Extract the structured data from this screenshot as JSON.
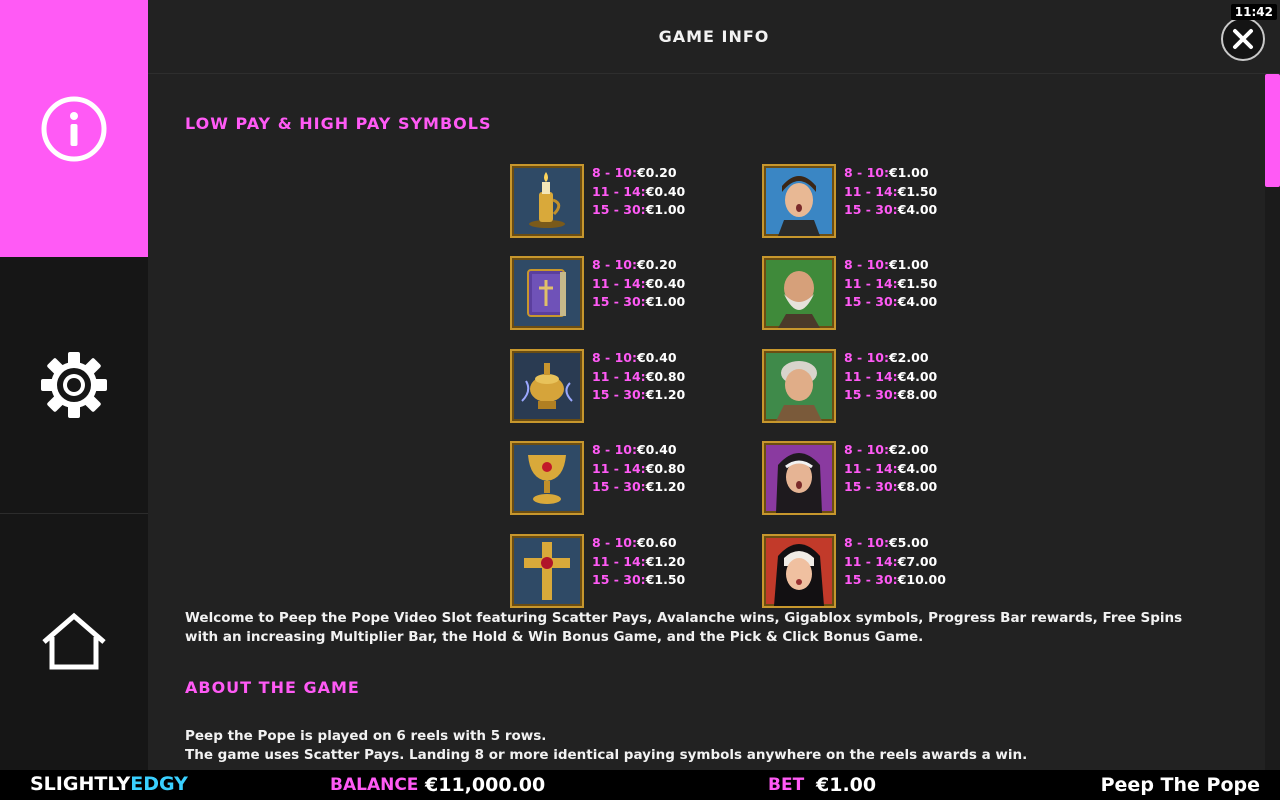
{
  "header": {
    "title": "GAME INFO",
    "clock": "11:42"
  },
  "sidebar": {
    "items": [
      {
        "name": "info",
        "icon": "info-icon",
        "active": true
      },
      {
        "name": "settings",
        "icon": "gear-icon",
        "active": false
      },
      {
        "name": "home",
        "icon": "home-icon",
        "active": false
      }
    ]
  },
  "colors": {
    "accent": "#ff5af5",
    "background": "#222222",
    "sidebar": "#161616",
    "tile_border": "#c7972d"
  },
  "sections": {
    "paytable_title": "LOW PAY & HIGH PAY SYMBOLS",
    "about_title": "ABOUT THE GAME"
  },
  "low_pay": [
    {
      "symbol": "candle-icon",
      "pays": [
        {
          "range": "8 - 10:",
          "amount": "€0.20"
        },
        {
          "range": "11 - 14:",
          "amount": "€0.40"
        },
        {
          "range": "15 - 30:",
          "amount": "€1.00"
        }
      ]
    },
    {
      "symbol": "book-icon",
      "pays": [
        {
          "range": "8 - 10:",
          "amount": "€0.20"
        },
        {
          "range": "11 - 14:",
          "amount": "€0.40"
        },
        {
          "range": "15 - 30:",
          "amount": "€1.00"
        }
      ]
    },
    {
      "symbol": "censer-icon",
      "pays": [
        {
          "range": "8 - 10:",
          "amount": "€0.40"
        },
        {
          "range": "11 - 14:",
          "amount": "€0.80"
        },
        {
          "range": "15 - 30:",
          "amount": "€1.20"
        }
      ]
    },
    {
      "symbol": "chalice-icon",
      "pays": [
        {
          "range": "8 - 10:",
          "amount": "€0.40"
        },
        {
          "range": "11 - 14:",
          "amount": "€0.80"
        },
        {
          "range": "15 - 30:",
          "amount": "€1.20"
        }
      ]
    },
    {
      "symbol": "cross-icon",
      "pays": [
        {
          "range": "8 - 10:",
          "amount": "€0.60"
        },
        {
          "range": "11 - 14:",
          "amount": "€1.20"
        },
        {
          "range": "15 - 30:",
          "amount": "€1.50"
        }
      ]
    }
  ],
  "high_pay": [
    {
      "symbol": "boy-icon",
      "pays": [
        {
          "range": "8 - 10:",
          "amount": "€1.00"
        },
        {
          "range": "11 - 14:",
          "amount": "€1.50"
        },
        {
          "range": "15 - 30:",
          "amount": "€4.00"
        }
      ]
    },
    {
      "symbol": "old-man-icon",
      "pays": [
        {
          "range": "8 - 10:",
          "amount": "€1.00"
        },
        {
          "range": "11 - 14:",
          "amount": "€1.50"
        },
        {
          "range": "15 - 30:",
          "amount": "€4.00"
        }
      ]
    },
    {
      "symbol": "old-woman-icon",
      "pays": [
        {
          "range": "8 - 10:",
          "amount": "€2.00"
        },
        {
          "range": "11 - 14:",
          "amount": "€4.00"
        },
        {
          "range": "15 - 30:",
          "amount": "€8.00"
        }
      ]
    },
    {
      "symbol": "nun-icon",
      "pays": [
        {
          "range": "8 - 10:",
          "amount": "€2.00"
        },
        {
          "range": "11 - 14:",
          "amount": "€4.00"
        },
        {
          "range": "15 - 30:",
          "amount": "€8.00"
        }
      ]
    },
    {
      "symbol": "young-nun-icon",
      "pays": [
        {
          "range": "8 - 10:",
          "amount": "€5.00"
        },
        {
          "range": "11 - 14:",
          "amount": "€7.00"
        },
        {
          "range": "15 - 30:",
          "amount": "€10.00"
        }
      ]
    }
  ],
  "text": {
    "welcome": "Welcome to Peep the Pope Video Slot featuring Scatter Pays, Avalanche wins, Gigablox symbols, Progress Bar rewards, Free Spins with an increasing Multiplier Bar, the Hold & Win Bonus Game, and the Pick & Click Bonus Game.",
    "about_1": "Peep the Pope is played on 6 reels with 5 rows.",
    "about_2": "The game uses Scatter Pays. Landing 8 or more identical paying symbols anywhere on the reels awards a win."
  },
  "footer": {
    "logo_part1": "SLIGHTLY",
    "logo_part2": "EDGY",
    "balance_label": "BALANCE",
    "balance_value": "€11,000.00",
    "bet_label": "BET",
    "bet_value": "€1.00",
    "game_name": "Peep The Pope"
  }
}
